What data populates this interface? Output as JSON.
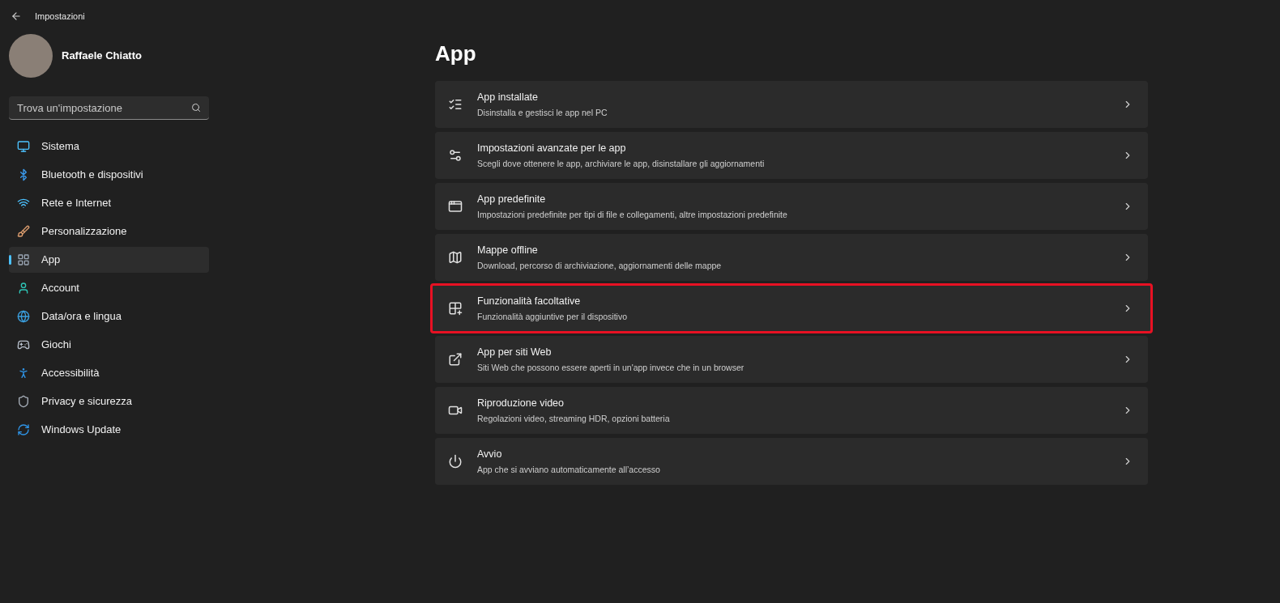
{
  "window": {
    "title": "Impostazioni"
  },
  "user": {
    "name": "Raffaele Chiatto"
  },
  "search": {
    "placeholder": "Trova un'impostazione"
  },
  "sidebar": {
    "items": [
      {
        "label": "Sistema",
        "kind": "system",
        "selected": false
      },
      {
        "label": "Bluetooth e dispositivi",
        "kind": "bluetooth",
        "selected": false
      },
      {
        "label": "Rete e Internet",
        "kind": "network",
        "selected": false
      },
      {
        "label": "Personalizzazione",
        "kind": "brush",
        "selected": false
      },
      {
        "label": "App",
        "kind": "apps",
        "selected": true
      },
      {
        "label": "Account",
        "kind": "account",
        "selected": false
      },
      {
        "label": "Data/ora e lingua",
        "kind": "time",
        "selected": false
      },
      {
        "label": "Giochi",
        "kind": "gaming",
        "selected": false
      },
      {
        "label": "Accessibilità",
        "kind": "accessibility",
        "selected": false
      },
      {
        "label": "Privacy e sicurezza",
        "kind": "privacy",
        "selected": false
      },
      {
        "label": "Windows Update",
        "kind": "update",
        "selected": false
      }
    ]
  },
  "page": {
    "title": "App",
    "items": [
      {
        "title": "App installate",
        "subtitle": "Disinstalla e gestisci le app nel PC",
        "kind": "list",
        "highlighted": false
      },
      {
        "title": "Impostazioni avanzate per le app",
        "subtitle": "Scegli dove ottenere le app, archiviare le app, disinstallare gli aggiornamenti",
        "kind": "advanced",
        "highlighted": false
      },
      {
        "title": "App predefinite",
        "subtitle": "Impostazioni predefinite per tipi di file e collegamenti, altre impostazioni predefinite",
        "kind": "default",
        "highlighted": false
      },
      {
        "title": "Mappe offline",
        "subtitle": "Download, percorso di archiviazione, aggiornamenti delle mappe",
        "kind": "map",
        "highlighted": false
      },
      {
        "title": "Funzionalità facoltative",
        "subtitle": "Funzionalità aggiuntive per il dispositivo",
        "kind": "optional",
        "highlighted": true
      },
      {
        "title": "App per siti Web",
        "subtitle": "Siti Web che possono essere aperti in un'app invece che in un browser",
        "kind": "web",
        "highlighted": false
      },
      {
        "title": "Riproduzione video",
        "subtitle": "Regolazioni video, streaming HDR, opzioni batteria",
        "kind": "video",
        "highlighted": false
      },
      {
        "title": "Avvio",
        "subtitle": "App che si avviano automaticamente all’accesso",
        "kind": "startup",
        "highlighted": false
      }
    ]
  }
}
